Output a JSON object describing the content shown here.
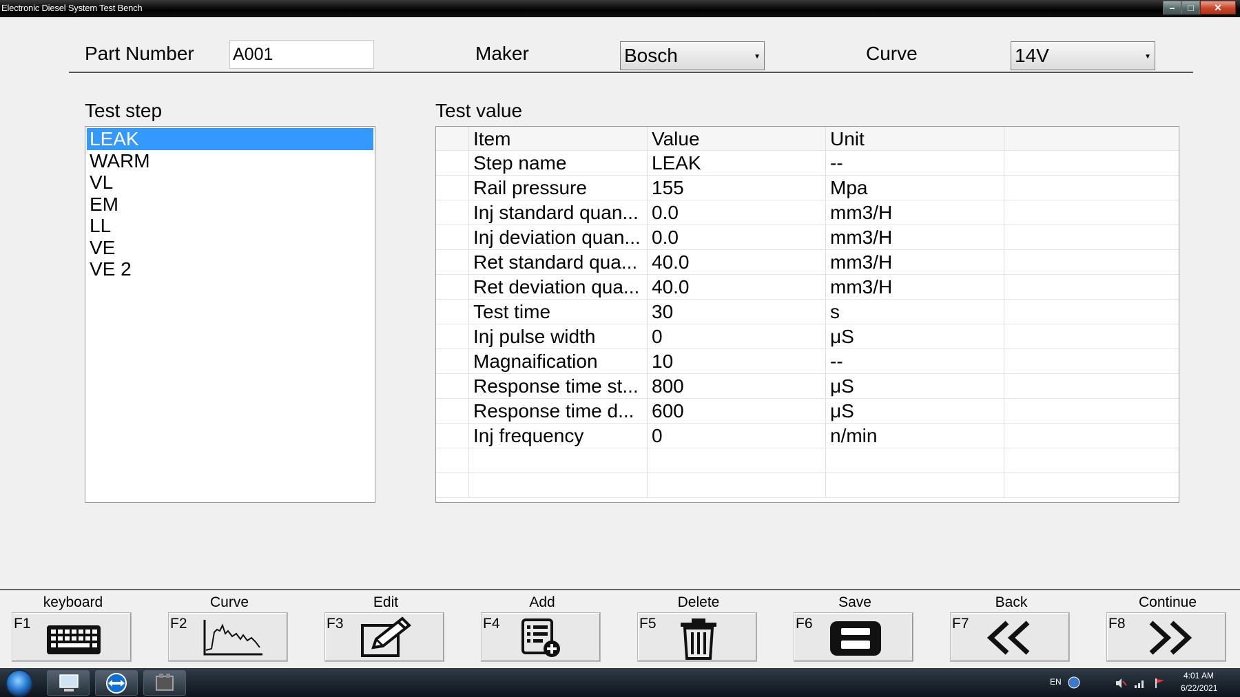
{
  "window": {
    "title": "Electronic Diesel System Test Bench",
    "min_symbol": "–",
    "max_symbol": "□",
    "close_symbol": "✕"
  },
  "header": {
    "part_number_label": "Part Number",
    "part_number_value": "A001",
    "maker_label": "Maker",
    "maker_value": "Bosch",
    "curve_label": "Curve",
    "curve_value": "14V",
    "arrow": "▼"
  },
  "test_step": {
    "label": "Test step",
    "items": [
      "LEAK",
      "WARM",
      "VL",
      "EM",
      "LL",
      "VE",
      "VE 2"
    ],
    "selected": 0
  },
  "test_value": {
    "label": "Test value",
    "columns": [
      "Item",
      "Value",
      "Unit"
    ],
    "rows": [
      [
        "Step name",
        "LEAK",
        "--"
      ],
      [
        "Rail pressure",
        "155",
        "Mpa"
      ],
      [
        "Inj standard quan...",
        "0.0",
        "mm3/H"
      ],
      [
        "Inj deviation quan...",
        "0.0",
        "mm3/H"
      ],
      [
        "Ret standard qua...",
        "40.0",
        "mm3/H"
      ],
      [
        "Ret deviation qua...",
        "40.0",
        "mm3/H"
      ],
      [
        "Test time",
        "30",
        "s"
      ],
      [
        "Inj pulse width",
        "0",
        "μS"
      ],
      [
        "Magnaification",
        "10",
        "--"
      ],
      [
        "Response time st...",
        "800",
        "μS"
      ],
      [
        "Response time d...",
        "600",
        "μS"
      ],
      [
        "Inj frequency",
        "0",
        "n/min"
      ]
    ]
  },
  "fkeys": [
    {
      "key": "F1",
      "label": "keyboard",
      "icon": "keyboard-icon"
    },
    {
      "key": "F2",
      "label": "Curve",
      "icon": "curve-icon"
    },
    {
      "key": "F3",
      "label": "Edit",
      "icon": "edit-icon"
    },
    {
      "key": "F4",
      "label": "Add",
      "icon": "add-icon"
    },
    {
      "key": "F5",
      "label": "Delete",
      "icon": "trash-icon"
    },
    {
      "key": "F6",
      "label": "Save",
      "icon": "save-icon"
    },
    {
      "key": "F7",
      "label": "Back",
      "icon": "back-icon"
    },
    {
      "key": "F8",
      "label": "Continue",
      "icon": "continue-icon"
    }
  ],
  "taskbar": {
    "lang": "EN",
    "time": "4:01 AM",
    "date": "6/22/2021"
  }
}
